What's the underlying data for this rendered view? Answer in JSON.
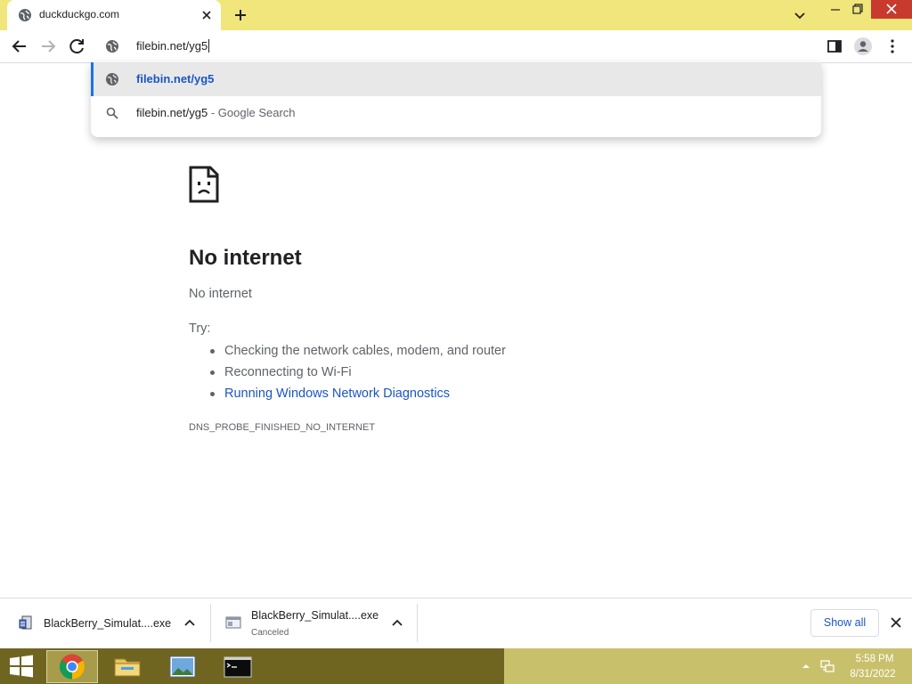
{
  "browser": {
    "tab": {
      "title": "duckduckgo.com"
    },
    "omnibox": {
      "value": "filebin.net/yg5"
    },
    "suggestions": [
      {
        "text": "filebin.net/yg5",
        "type": "url"
      },
      {
        "text": "filebin.net/yg5",
        "suffix": "- Google Search",
        "type": "search"
      }
    ]
  },
  "error_page": {
    "heading": "No internet",
    "subheading": "No internet",
    "try_label": "Try:",
    "suggestions": [
      "Checking the network cables, modem, and router",
      "Reconnecting to Wi-Fi",
      "Running Windows Network Diagnostics"
    ],
    "error_code": "DNS_PROBE_FINISHED_NO_INTERNET"
  },
  "downloads": {
    "items": [
      {
        "name": "BlackBerry_Simulat....exe",
        "status": ""
      },
      {
        "name": "BlackBerry_Simulat....exe",
        "status": "Canceled"
      }
    ],
    "show_all_label": "Show all"
  },
  "taskbar": {
    "apps": [
      "chrome-icon",
      "file-explorer-icon",
      "photos-icon",
      "cmd-icon"
    ],
    "time": "5:58 PM",
    "date": "8/31/2022"
  },
  "colors": {
    "titlebar": "#f0e67b",
    "taskbar": "#6f6521",
    "link": "#1a56c2",
    "accent": "#1a73e8",
    "close": "#c83a2d"
  }
}
